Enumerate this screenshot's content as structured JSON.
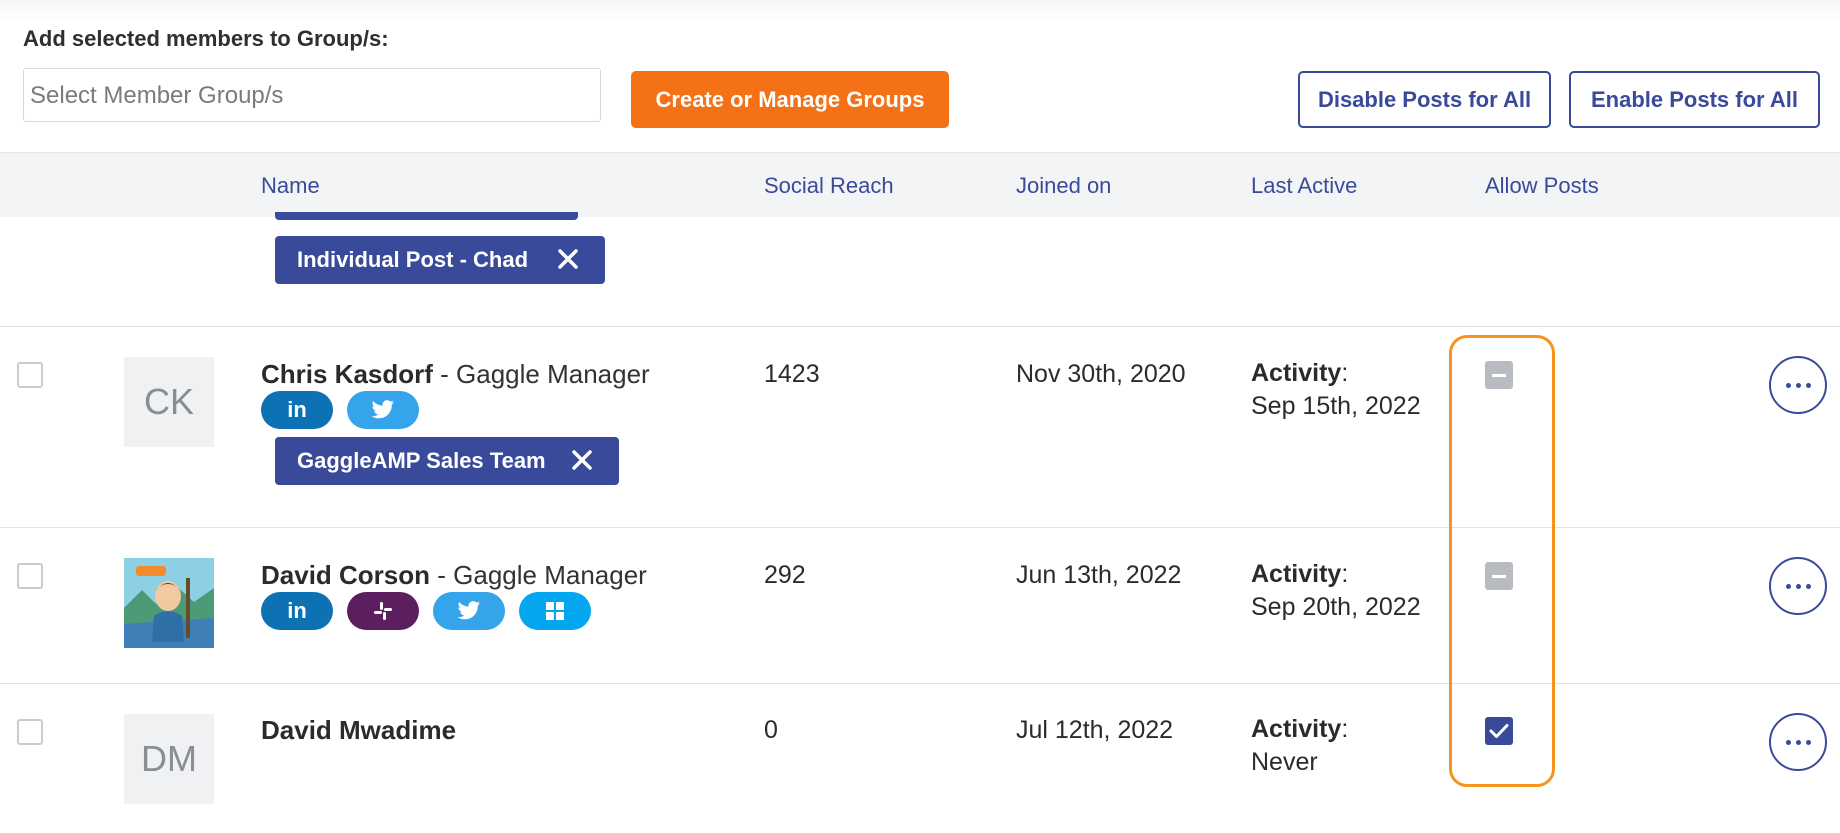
{
  "toolbar": {
    "group_label": "Add selected members to Group/s:",
    "group_placeholder": "Select Member Group/s",
    "create_label": "Create or Manage Groups",
    "disable_label": "Disable Posts for All",
    "enable_label": "Enable Posts for All"
  },
  "columns": {
    "name": "Name",
    "social_reach": "Social Reach",
    "joined_on": "Joined on",
    "last_active": "Last Active",
    "allow_posts": "Allow Posts"
  },
  "previous_row": {
    "tag": "Individual Post - Chad"
  },
  "members": [
    {
      "initials": "CK",
      "name": "Chris Kasdorf",
      "role": " - Gaggle Manager",
      "social": [
        "linkedin",
        "twitter"
      ],
      "tag": "GaggleAMP Sales Team",
      "social_reach": "1423",
      "joined_on": "Nov 30th, 2020",
      "activity_label": "Activity",
      "activity_sep": ":",
      "last_active": "Sep 15th, 2022",
      "allow_posts": "indeterminate"
    },
    {
      "initials": "",
      "name": "David Corson",
      "role": " - Gaggle Manager",
      "social": [
        "linkedin",
        "slack",
        "twitter",
        "microsoft"
      ],
      "social_reach": "292",
      "joined_on": "Jun 13th, 2022",
      "activity_label": "Activity",
      "activity_sep": ":",
      "last_active": "Sep 20th, 2022",
      "allow_posts": "indeterminate"
    },
    {
      "initials": "DM",
      "name": "David Mwadime",
      "role": "",
      "social": [],
      "social_reach": "0",
      "joined_on": "Jul 12th, 2022",
      "activity_label": "Activity",
      "activity_sep": ":",
      "last_active": "Never",
      "allow_posts": "checked"
    }
  ],
  "social_icons": {
    "linkedin_text": "in"
  },
  "colors": {
    "primary": "#3a4a9a",
    "accent_orange": "#f47115",
    "highlight": "#f7941d",
    "linkedin": "#0d72b3",
    "twitter": "#35a4ea",
    "slack": "#5b1f5f",
    "microsoft": "#05a6f0"
  }
}
